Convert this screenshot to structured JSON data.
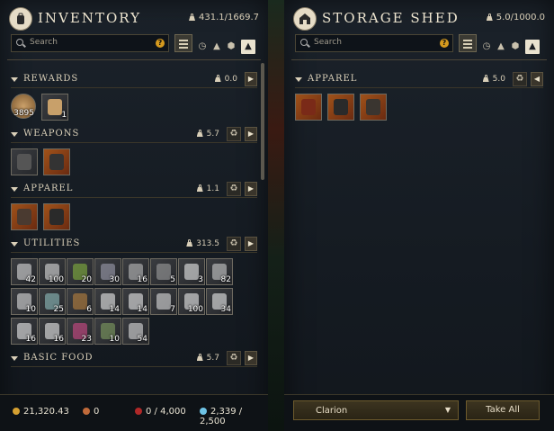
{
  "inventory": {
    "title": "INVENTORY",
    "weight": "431.1/1669.7",
    "search_placeholder": "Search",
    "categories": [
      {
        "name": "REWARDS",
        "weight": "0.0",
        "recycle": false
      },
      {
        "name": "WEAPONS",
        "weight": "5.7",
        "recycle": true
      },
      {
        "name": "APPAREL",
        "weight": "1.1",
        "recycle": true
      },
      {
        "name": "UTILITIES",
        "weight": "313.5",
        "recycle": true
      },
      {
        "name": "BASIC FOOD",
        "weight": "5.7",
        "recycle": true
      }
    ],
    "rewards_items": [
      {
        "qty": "3895",
        "style": "round"
      },
      {
        "qty": "1",
        "style": "gray"
      }
    ],
    "weapons_items": [
      {
        "qty": "",
        "style": "gray"
      },
      {
        "qty": "",
        "style": "orange"
      }
    ],
    "apparel_items": [
      {
        "qty": "",
        "style": "orange"
      },
      {
        "qty": "",
        "style": "orange"
      }
    ],
    "utilities_items": [
      {
        "qty": "42"
      },
      {
        "qty": "100"
      },
      {
        "qty": "20"
      },
      {
        "qty": "30"
      },
      {
        "qty": "16"
      },
      {
        "qty": "5"
      },
      {
        "qty": "3"
      },
      {
        "qty": "82"
      },
      {
        "qty": "10"
      },
      {
        "qty": "25"
      },
      {
        "qty": "6"
      },
      {
        "qty": "14"
      },
      {
        "qty": "14"
      },
      {
        "qty": "7"
      },
      {
        "qty": "100"
      },
      {
        "qty": "34"
      },
      {
        "qty": "16"
      },
      {
        "qty": "16"
      },
      {
        "qty": "23"
      },
      {
        "qty": "10"
      },
      {
        "qty": "54"
      }
    ],
    "footer": {
      "coin": "21,320.43",
      "faction": "0",
      "azoth": "0 / 4,000",
      "gems": "2,339 / 2,500"
    }
  },
  "storage": {
    "title": "STORAGE SHED",
    "weight": "5.0/1000.0",
    "search_placeholder": "Search",
    "category": {
      "name": "APPAREL",
      "weight": "5.0"
    },
    "apparel_items": [
      {
        "qty": ""
      },
      {
        "qty": ""
      },
      {
        "qty": ""
      }
    ],
    "location_select": "Clarion",
    "take_all_label": "Take All"
  },
  "colors": {
    "accent": "#d59a1e",
    "panel_bg": "#161c23",
    "text": "#d9cfb8"
  }
}
